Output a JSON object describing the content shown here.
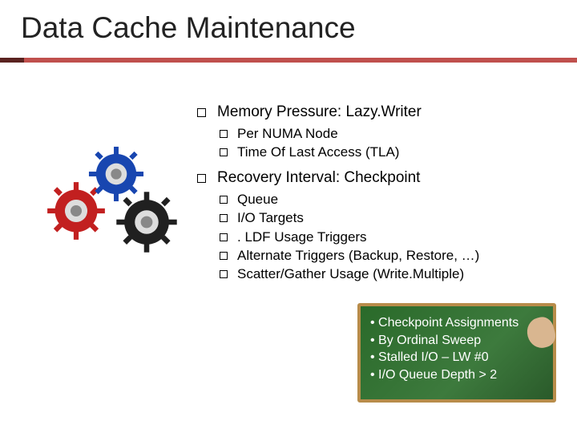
{
  "title": "Data Cache Maintenance",
  "sections": [
    {
      "label": "Memory Pressure: Lazy.Writer",
      "items": [
        "Per NUMA Node",
        "Time Of Last Access (TLA)"
      ]
    },
    {
      "label": "Recovery Interval: Checkpoint",
      "items": [
        "Queue",
        "I/O Targets",
        ". LDF Usage Triggers",
        "Alternate Triggers (Backup, Restore, …)",
        "Scatter/Gather Usage (Write.Multiple)"
      ]
    }
  ],
  "chalkboard": [
    "Checkpoint Assignments",
    "By Ordinal Sweep",
    "Stalled I/O – LW #0",
    "I/O Queue Depth > 2"
  ],
  "gears": {
    "colors": {
      "left": "#c22020",
      "top": "#1846b0",
      "right": "#202020"
    }
  }
}
